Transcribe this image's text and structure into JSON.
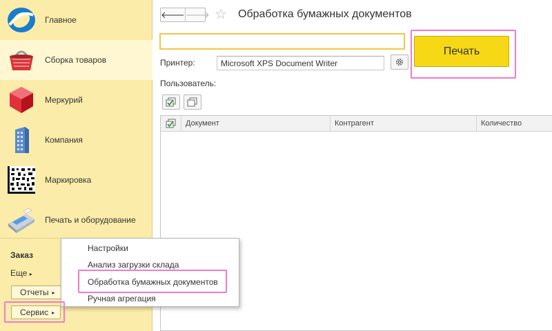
{
  "sidebar": {
    "items": [
      {
        "label": "Главное",
        "icon": "logo-icon"
      },
      {
        "label": "Сборка товаров",
        "icon": "basket-icon"
      },
      {
        "label": "Меркурий",
        "icon": "cube-icon"
      },
      {
        "label": "Компания",
        "icon": "building-icon"
      },
      {
        "label": "Маркировка",
        "icon": "datamatrix-icon"
      },
      {
        "label": "Печать и оборудование",
        "icon": "pos-terminal-icon"
      }
    ],
    "order_label": "Заказ",
    "more_label": "Еще",
    "reports_label": "Отчеты",
    "service_label": "Сервис"
  },
  "popup": {
    "items": [
      "Настройки",
      "Анализ загрузки склада",
      "Обработка бумажных документов",
      "Ручная агрегация"
    ]
  },
  "header": {
    "back_glyph": "🡐",
    "forward_glyph": "🡒",
    "title": "Обработка бумажных документов"
  },
  "form": {
    "barcode_value": "",
    "print_label": "Печать",
    "printer_label": "Принтер:",
    "printer_value": "Microsoft XPS Document Writer",
    "user_label": "Пользователь:"
  },
  "table": {
    "columns": [
      "Документ",
      "Контрагент",
      "Количество"
    ],
    "rows": []
  },
  "colors": {
    "sidebar_bg": "#fbeca9",
    "accent_yellow": "#f7d816",
    "highlight_pink": "#f279c9",
    "input_border": "#f0c844"
  }
}
